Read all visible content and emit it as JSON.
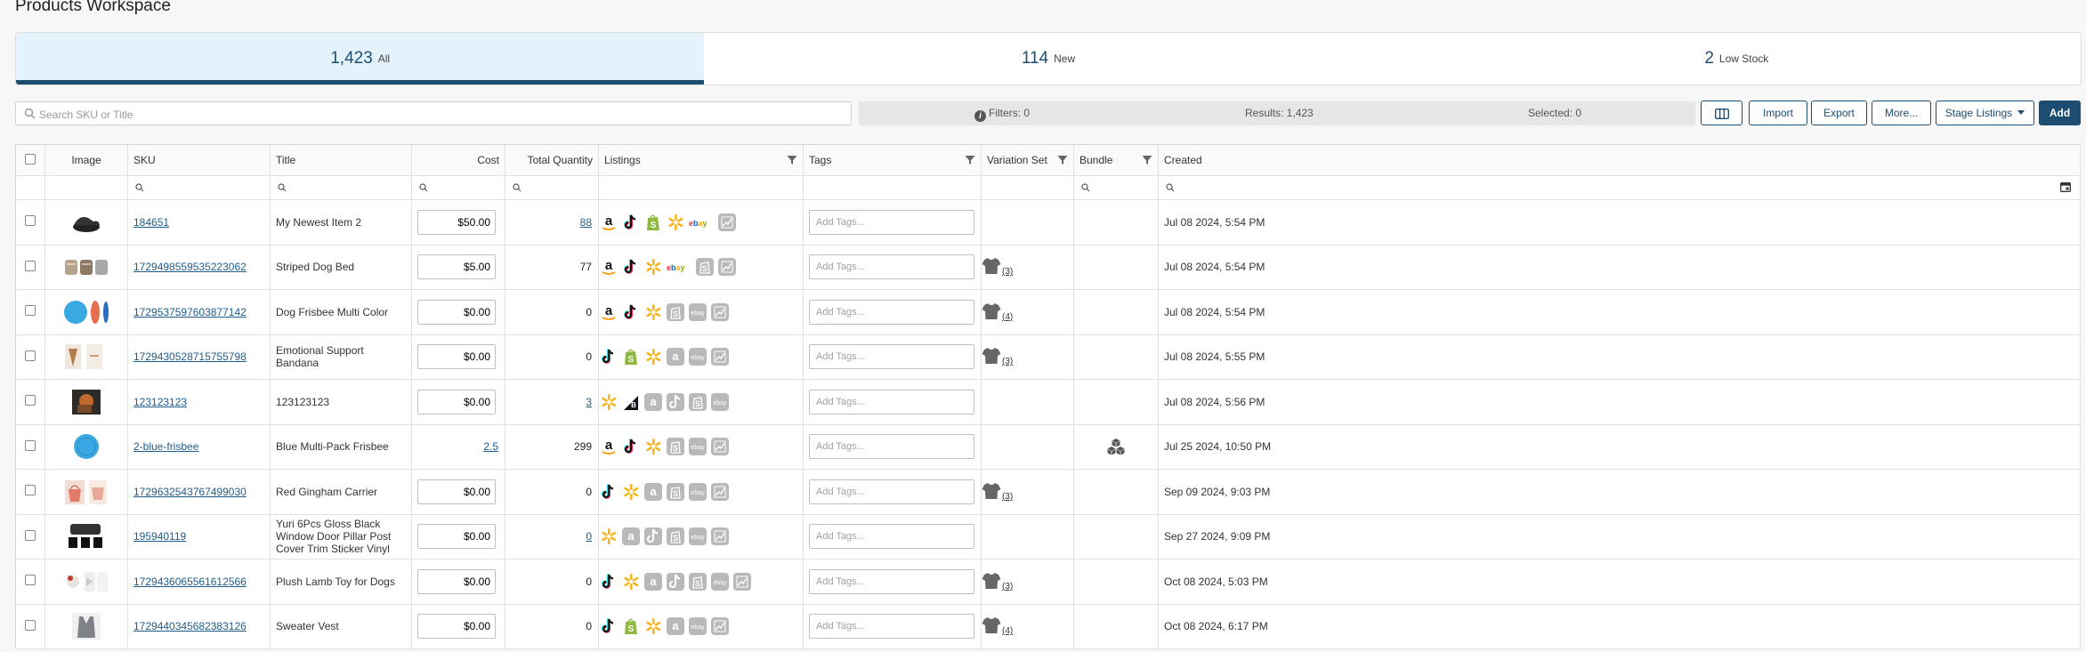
{
  "page_title": "Products Workspace",
  "summary": [
    {
      "count": "1,423",
      "label": "All",
      "active": true
    },
    {
      "count": "114",
      "label": "New",
      "active": false
    },
    {
      "count": "2",
      "label": "Low Stock",
      "active": false
    }
  ],
  "search": {
    "placeholder": "Search SKU or Title",
    "value": ""
  },
  "stats": {
    "filters": "Filters: 0",
    "results": "Results: 1,423",
    "selected": "Selected: 0"
  },
  "toolbar": {
    "import": "Import",
    "export": "Export",
    "more": "More...",
    "stage": "Stage Listings",
    "add": "Add"
  },
  "columns": {
    "image": "Image",
    "sku": "SKU",
    "title": "Title",
    "cost": "Cost",
    "quantity": "Total Quantity",
    "listings": "Listings",
    "tags": "Tags",
    "variation": "Variation Set",
    "bundle": "Bundle",
    "created": "Created"
  },
  "tags_placeholder": "Add Tags...",
  "colors": {
    "brand": "#1d4e72",
    "tab_active_bg": "#e4f3fb",
    "link": "#1f5c8a",
    "amazon": "#111111",
    "tiktok": "#111111",
    "shopify": "#8fb83e",
    "walmart": "#f6b51e",
    "ebay_red": "#e53238",
    "ebay_blue": "#0064d2",
    "ebay_yellow": "#f5af02",
    "ebay_green": "#86b817",
    "inactive": "#b9b9b9"
  },
  "rows": [
    {
      "thumb": "shoe",
      "sku": "184651",
      "title": "My Newest Item 2",
      "cost": "$50.00",
      "qty": "88",
      "qty_link": true,
      "listings": [
        [
          "amazon",
          "active"
        ],
        [
          "tiktok",
          "active"
        ],
        [
          "shopify",
          "active"
        ],
        [
          "walmart",
          "active"
        ],
        [
          "ebay",
          "active"
        ],
        [
          "generic",
          "inactive"
        ]
      ],
      "variation": "",
      "bundle": false,
      "created": "Jul 08 2024, 5:54 PM"
    },
    {
      "thumb": "bed",
      "sku": "1729498559535223062",
      "title": "Striped Dog Bed",
      "cost": "$5.00",
      "qty": "77",
      "qty_link": false,
      "listings": [
        [
          "amazon",
          "active"
        ],
        [
          "tiktok",
          "active"
        ],
        [
          "walmart",
          "active"
        ],
        [
          "ebay",
          "active"
        ],
        [
          "shopify",
          "inactive"
        ],
        [
          "generic",
          "inactive"
        ]
      ],
      "variation": "(3)",
      "bundle": false,
      "created": "Jul 08 2024, 5:54 PM"
    },
    {
      "thumb": "frisbee",
      "sku": "1729537597603877142",
      "title": "Dog Frisbee Multi Color",
      "cost": "$0.00",
      "qty": "0",
      "qty_link": false,
      "listings": [
        [
          "amazon",
          "active"
        ],
        [
          "tiktok",
          "active"
        ],
        [
          "walmart",
          "active"
        ],
        [
          "shopify",
          "inactive"
        ],
        [
          "ebay",
          "inactive"
        ],
        [
          "generic",
          "inactive"
        ]
      ],
      "variation": "(4)",
      "bundle": false,
      "created": "Jul 08 2024, 5:54 PM"
    },
    {
      "thumb": "bandana",
      "sku": "1729430528715755798",
      "title": "Emotional Support Bandana",
      "cost": "$0.00",
      "qty": "0",
      "qty_link": false,
      "listings": [
        [
          "tiktok",
          "active"
        ],
        [
          "shopify",
          "active"
        ],
        [
          "walmart",
          "active"
        ],
        [
          "amazon",
          "inactive"
        ],
        [
          "ebay",
          "inactive"
        ],
        [
          "generic",
          "inactive"
        ]
      ],
      "variation": "(3)",
      "bundle": false,
      "created": "Jul 08 2024, 5:55 PM"
    },
    {
      "thumb": "photo",
      "sku": "123123123",
      "title": "123123123",
      "cost": "$0.00",
      "qty": "3",
      "qty_link": true,
      "listings": [
        [
          "walmart",
          "active"
        ],
        [
          "bigcommerce",
          "active"
        ],
        [
          "amazon",
          "inactive"
        ],
        [
          "tiktok",
          "inactive"
        ],
        [
          "shopify",
          "inactive"
        ],
        [
          "ebay",
          "inactive"
        ]
      ],
      "variation": "",
      "bundle": false,
      "created": "Jul 08 2024, 5:56 PM"
    },
    {
      "thumb": "bluefrisbee",
      "sku": "2-blue-frisbee",
      "title": "Blue Multi-Pack Frisbee",
      "cost": "2.5",
      "cost_link": true,
      "qty": "299",
      "qty_link": false,
      "listings": [
        [
          "amazon",
          "active"
        ],
        [
          "tiktok",
          "active"
        ],
        [
          "walmart",
          "active"
        ],
        [
          "shopify",
          "inactive"
        ],
        [
          "ebay",
          "inactive"
        ],
        [
          "generic",
          "inactive"
        ]
      ],
      "variation": "",
      "bundle": true,
      "created": "Jul 25 2024, 10:50 PM"
    },
    {
      "thumb": "carrier",
      "sku": "1729632543767499030",
      "title": "Red Gingham Carrier",
      "cost": "$0.00",
      "qty": "0",
      "qty_link": false,
      "listings": [
        [
          "tiktok",
          "active"
        ],
        [
          "walmart",
          "active"
        ],
        [
          "amazon",
          "inactive"
        ],
        [
          "shopify",
          "inactive"
        ],
        [
          "ebay",
          "inactive"
        ],
        [
          "generic",
          "inactive"
        ]
      ],
      "variation": "(3)",
      "bundle": false,
      "created": "Sep 09 2024, 9:03 PM"
    },
    {
      "thumb": "car",
      "sku": "195940119",
      "title": "Yuri 6Pcs Gloss Black Window Door Pillar Post Cover Trim Sticker Vinyl",
      "cost": "$0.00",
      "qty": "0",
      "qty_link": true,
      "listings": [
        [
          "walmart",
          "active"
        ],
        [
          "amazon",
          "inactive"
        ],
        [
          "tiktok",
          "inactive"
        ],
        [
          "shopify",
          "inactive"
        ],
        [
          "ebay",
          "inactive"
        ],
        [
          "generic",
          "inactive"
        ]
      ],
      "variation": "",
      "bundle": false,
      "created": "Sep 27 2024, 9:09 PM"
    },
    {
      "thumb": "lamb",
      "sku": "1729436065561612566",
      "title": "Plush Lamb Toy for Dogs",
      "cost": "$0.00",
      "qty": "0",
      "qty_link": false,
      "listings": [
        [
          "tiktok",
          "active"
        ],
        [
          "walmart",
          "active"
        ],
        [
          "amazon",
          "inactive"
        ],
        [
          "tiktok",
          "inactive"
        ],
        [
          "shopify",
          "inactive"
        ],
        [
          "ebay",
          "inactive"
        ],
        [
          "generic",
          "inactive"
        ]
      ],
      "variation": "(3)",
      "bundle": false,
      "created": "Oct 08 2024, 5:03 PM"
    },
    {
      "thumb": "vest",
      "sku": "1729440345682383126",
      "title": "Sweater Vest",
      "cost": "$0.00",
      "qty": "0",
      "qty_link": false,
      "listings": [
        [
          "tiktok",
          "active"
        ],
        [
          "shopify",
          "active"
        ],
        [
          "walmart",
          "active"
        ],
        [
          "amazon",
          "inactive"
        ],
        [
          "ebay",
          "inactive"
        ],
        [
          "generic",
          "inactive"
        ]
      ],
      "variation": "(4)",
      "bundle": false,
      "created": "Oct 08 2024, 6:17 PM"
    }
  ]
}
